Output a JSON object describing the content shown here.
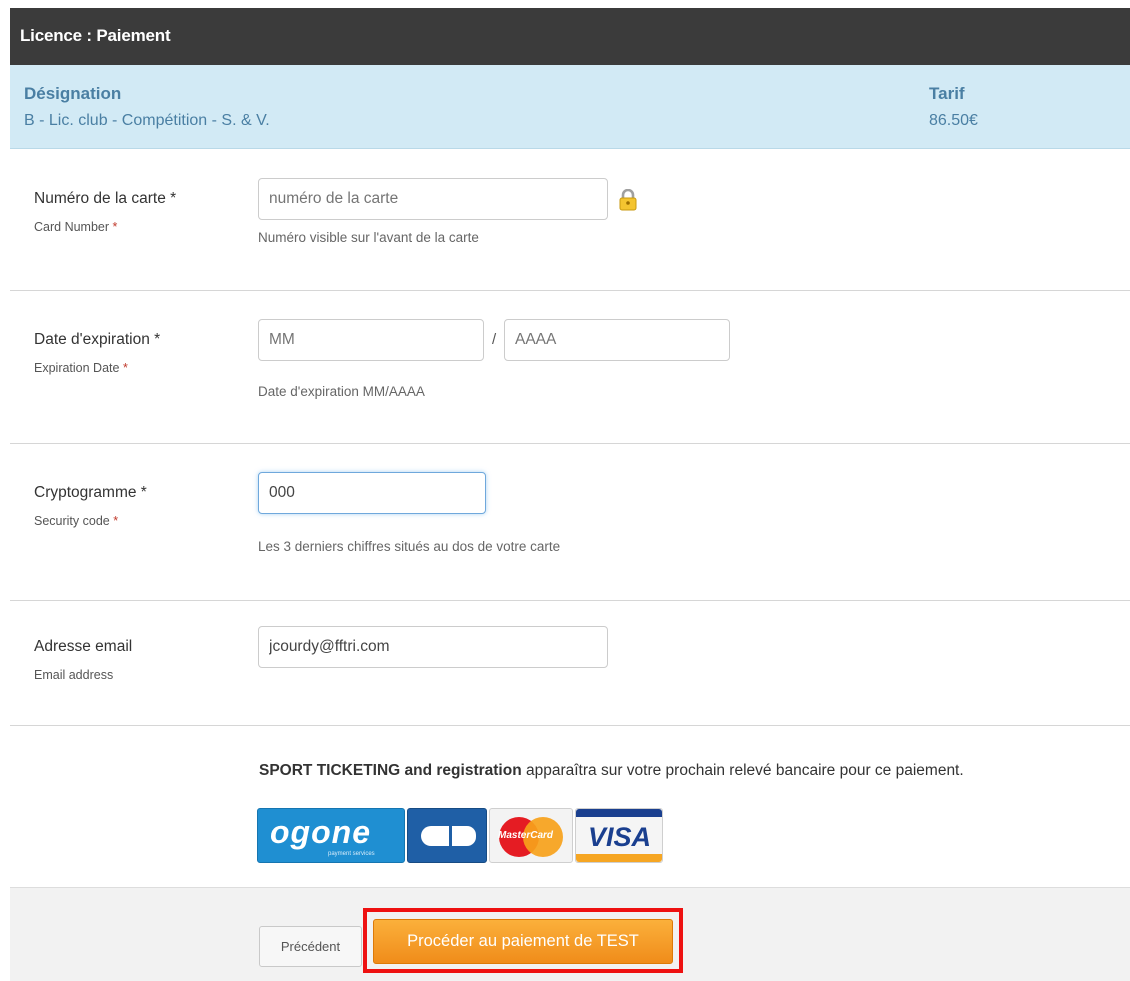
{
  "header": {
    "title": "Licence : Paiement"
  },
  "pricing": {
    "designation_label": "Désignation",
    "designation_value": "B - Lic. club - Compétition - S. & V.",
    "tarif_label": "Tarif",
    "tarif_value": "86.50€"
  },
  "form": {
    "card_number": {
      "label": "Numéro de la carte *",
      "sublabel": "Card Number",
      "placeholder": "numéro de la carte",
      "help": "Numéro visible sur l'avant de la carte"
    },
    "expiration": {
      "label": "Date d'expiration *",
      "sublabel": "Expiration Date",
      "month_placeholder": "MM",
      "separator": "/",
      "year_placeholder": "AAAA",
      "help": "Date d'expiration MM/AAAA"
    },
    "cvv": {
      "label": "Cryptogramme *",
      "sublabel": "Security code",
      "value": "000",
      "help": "Les 3 derniers chiffres situés au dos de votre carte"
    },
    "email": {
      "label": "Adresse email",
      "sublabel": "Email address",
      "value": "jcourdy@fftri.com"
    },
    "required_marker": "*"
  },
  "statement": {
    "bold": "SPORT TICKETING and registration",
    "rest": " apparaîtra sur votre prochain relevé bancaire pour ce paiement."
  },
  "logos": {
    "ogone": "ogone",
    "ogone_sub": "payment services",
    "mastercard": "MasterCard",
    "visa": "VISA"
  },
  "buttons": {
    "previous": "Précédent",
    "pay": "Procéder au paiement de TEST"
  },
  "colors": {
    "header_bg": "#3b3b3b",
    "price_bg": "#d2eaf5",
    "pay_button": "#f39c12",
    "highlight": "#ee1111"
  }
}
